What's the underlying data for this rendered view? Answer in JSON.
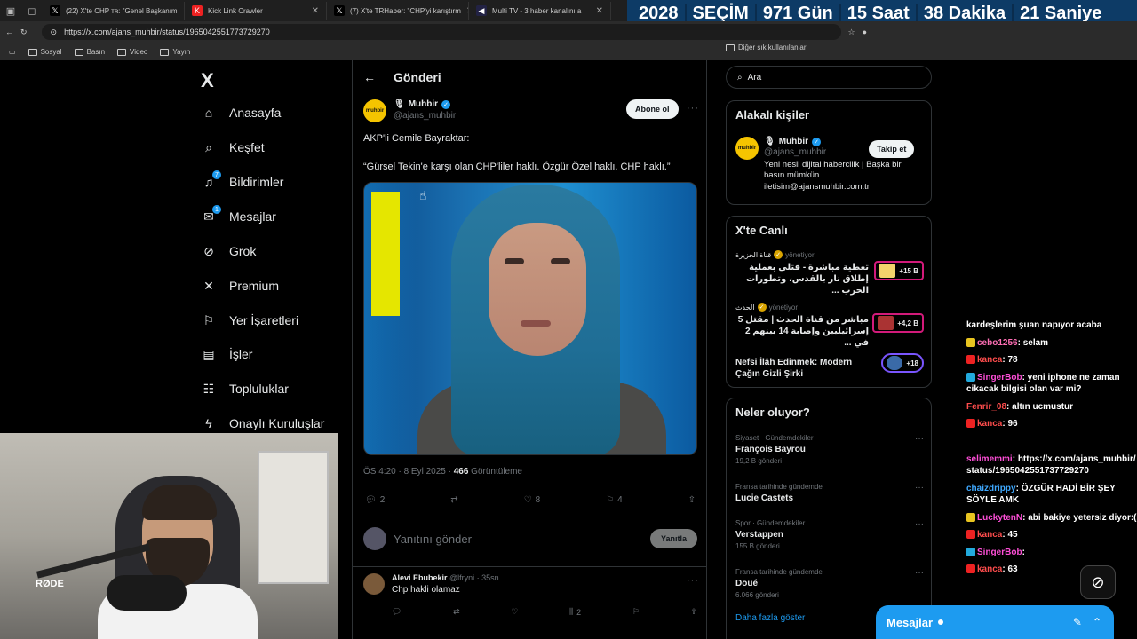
{
  "browser": {
    "tabs": [
      {
        "label": "(22) X'te CHP ᴛʀ: \"Genel Başkanım",
        "icon": "x-logo"
      },
      {
        "label": "Kick Link Crawler",
        "icon": "kick-logo"
      },
      {
        "label": "(7) X'te TRHaber: \"CHP'yi karıştırm",
        "icon": "x-logo"
      },
      {
        "label": "Multi TV - 3 haber kanalını a",
        "icon": "tv-icon"
      }
    ],
    "url": "https://x.com/ajans_muhbir/status/1965042551773729270",
    "bookmarks": [
      "Sosyal",
      "Basın",
      "Video",
      "Yayın"
    ],
    "other_bookmarks": "Diğer sık kullanılanlar"
  },
  "countdown": {
    "year": "2028",
    "label": "SEÇİM",
    "days": "971 Gün",
    "hours": "15 Saat",
    "minutes": "38 Dakika",
    "seconds": "21 Saniye"
  },
  "nav": {
    "logo": "X",
    "items": [
      {
        "label": "Anasayfa",
        "icon": "home-icon"
      },
      {
        "label": "Keşfet",
        "icon": "search-icon"
      },
      {
        "label": "Bildirimler",
        "icon": "bell-icon",
        "badge": "7"
      },
      {
        "label": "Mesajlar",
        "icon": "mail-icon",
        "badge": "1"
      },
      {
        "label": "Grok",
        "icon": "grok-icon"
      },
      {
        "label": "Premium",
        "icon": "x-icon"
      },
      {
        "label": "Yer İşaretleri",
        "icon": "bookmark-icon"
      },
      {
        "label": "İşler",
        "icon": "briefcase-icon"
      },
      {
        "label": "Topluluklar",
        "icon": "people-icon"
      },
      {
        "label": "Onaylı Kuruluşlar",
        "icon": "lightning-icon"
      }
    ]
  },
  "post": {
    "header": "Gönderi",
    "author_name": "Muhbir",
    "author_handle": "@ajans_muhbir",
    "avatar_text": "muhbir",
    "subscribe": "Abone ol",
    "line1": "AKP'li Cemile Bayraktar:",
    "line2": "“Gürsel Tekin'e karşı olan CHP'liler haklı. Özgür Özel haklı. CHP haklı.”",
    "time": "ÖS 4:20 · 8 Eyl 2025 · ",
    "views_count": "466",
    "views_label": " Görüntüleme",
    "replies": "2",
    "likes": "8",
    "bookmarks": "4",
    "reply_placeholder": "Yanıtını gönder",
    "reply_button": "Yanıtla"
  },
  "comment": {
    "name": "Alevi Ebubekir",
    "handle": " @lfryni · 35sn",
    "text": "Chp hakli olamaz",
    "views": "2"
  },
  "sidebar": {
    "search_placeholder": "Ara",
    "related_title": "Alakalı kişiler",
    "related_name": "Muhbir",
    "related_handle": "@ajans_muhbir",
    "related_bio": "Yeni nesil dijital habercilik | Başka bir basın mümkün. iletisim@ajansmuhbir.com.tr",
    "follow": "Takip et",
    "live_title": "X'te Canlı",
    "live": [
      {
        "host": "قناة الجزيرة",
        "role": "yönetiyor",
        "title": "تغطية مباشرة - قتلى بعملية إطلاق نار بالقدس، وتطورات الحرب ...",
        "count": "+15 B"
      },
      {
        "host": "الحدث",
        "role": "yönetiyor",
        "title": "مباشر من قناة الحدث | مقتل 5 إسرائيليين وإصابة 14 بينهم 2 في ...",
        "count": "+4,2 B"
      },
      {
        "host": "",
        "role": "",
        "title": "Nefsi İlâh Edinmek: Modern Çağın Gizli Şirki",
        "count": "+18"
      }
    ],
    "trends_title": "Neler oluyor?",
    "trends": [
      {
        "cat": "Siyaset · Gündemdekiler",
        "name": "François Bayrou",
        "count": "19,2 B gönderi"
      },
      {
        "cat": "Fransa tarihinde gündemde",
        "name": "Lucie Castets",
        "count": ""
      },
      {
        "cat": "Spor · Gündemdekiler",
        "name": "Verstappen",
        "count": "155 B gönderi"
      },
      {
        "cat": "Fransa tarihinde gündemde",
        "name": "Doué",
        "count": "6.066 gönderi"
      }
    ],
    "show_more": "Daha fazla göster"
  },
  "chat": [
    {
      "user": "",
      "text": "kardeşlerim şuan napıyor acaba",
      "color": "#ffffff"
    },
    {
      "user": "cebo1256",
      "text": "selam",
      "color": "#ff6fb5"
    },
    {
      "user": "kanca",
      "text": "78",
      "color": "#ff4d4d"
    },
    {
      "user": "SingerBob",
      "text": "yeni iphone ne zaman cikacak bilgisi olan var mi?",
      "color": "#ff4fd8"
    },
    {
      "user": "Fenrir_08",
      "text": "altın ucmustur",
      "color": "#ff4d4d"
    },
    {
      "user": "kanca",
      "text": "96",
      "color": "#ff4d4d"
    },
    {
      "user": "selimemmi",
      "text": "https://x.com/ajans_muhbir/status/1965042551737729270",
      "color": "#ff4fd8"
    },
    {
      "user": "chaizdrippy",
      "text": "ÖZGÜR HADİ BİR ŞEY SÖYLE AMK",
      "color": "#3fa9ff"
    },
    {
      "user": "LuckytenN",
      "text": "abi bakiye yetersiz diyor:(",
      "color": "#ff4fd8"
    },
    {
      "user": "kanca",
      "text": "45",
      "color": "#ff4d4d"
    },
    {
      "user": "SingerBob",
      "text": "",
      "color": "#ff4fd8"
    },
    {
      "user": "kanca",
      "text": "63",
      "color": "#ff4d4d"
    }
  ],
  "dm": {
    "label": "Mesajlar"
  }
}
